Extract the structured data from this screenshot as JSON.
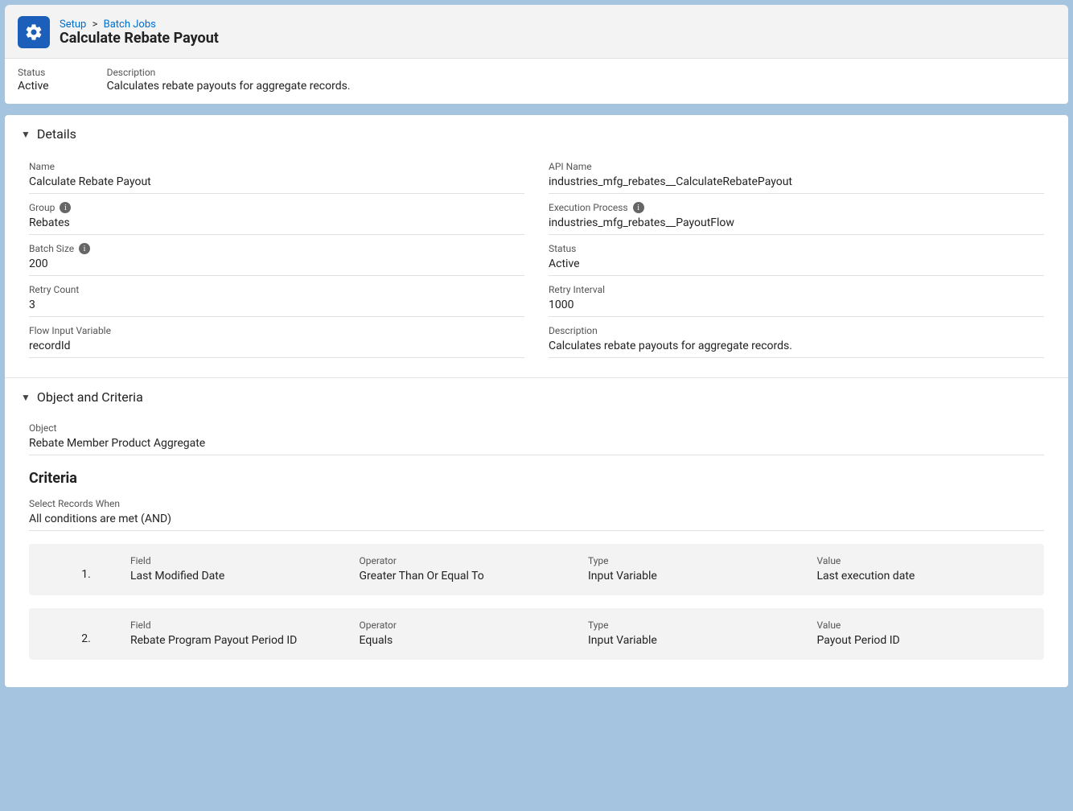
{
  "breadcrumb": {
    "setup": "Setup",
    "batch_jobs": "Batch Jobs"
  },
  "page_title": "Calculate Rebate Payout",
  "summary": {
    "status_label": "Status",
    "status_value": "Active",
    "description_label": "Description",
    "description_value": "Calculates rebate payouts for aggregate records."
  },
  "sections": {
    "details_title": "Details",
    "object_criteria_title": "Object and Criteria"
  },
  "details": {
    "name_label": "Name",
    "name_value": "Calculate Rebate Payout",
    "api_name_label": "API Name",
    "api_name_value": "industries_mfg_rebates__CalculateRebatePayout",
    "group_label": "Group",
    "group_value": "Rebates",
    "execution_process_label": "Execution Process",
    "execution_process_value": "industries_mfg_rebates__PayoutFlow",
    "batch_size_label": "Batch Size",
    "batch_size_value": "200",
    "status_label": "Status",
    "status_value": "Active",
    "retry_count_label": "Retry Count",
    "retry_count_value": "3",
    "retry_interval_label": "Retry Interval",
    "retry_interval_value": "1000",
    "flow_input_label": "Flow Input Variable",
    "flow_input_value": "recordId",
    "description_label": "Description",
    "description_value": "Calculates rebate payouts for aggregate records."
  },
  "object_criteria": {
    "object_label": "Object",
    "object_value": "Rebate Member Product Aggregate",
    "criteria_title": "Criteria",
    "select_when_label": "Select Records When",
    "select_when_value": "All conditions are met (AND)",
    "headers": {
      "field": "Field",
      "operator": "Operator",
      "type": "Type",
      "value": "Value"
    },
    "rows": [
      {
        "index": "1.",
        "field": "Last Modified Date",
        "operator": "Greater Than Or Equal To",
        "type": "Input Variable",
        "value": "Last execution date"
      },
      {
        "index": "2.",
        "field": "Rebate Program Payout Period ID",
        "operator": "Equals",
        "type": "Input Variable",
        "value": "Payout Period ID"
      }
    ]
  }
}
